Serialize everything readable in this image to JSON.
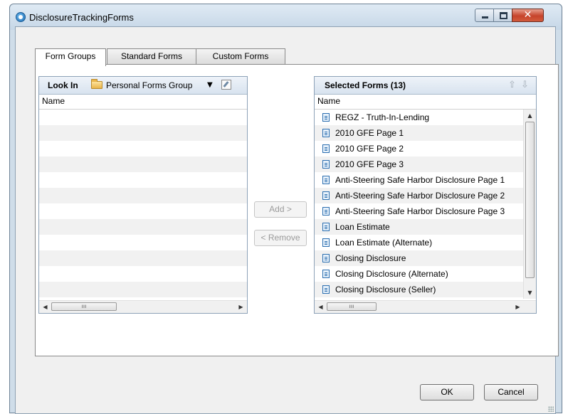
{
  "window": {
    "title": "DisclosureTrackingForms"
  },
  "tabs": [
    {
      "label": "Form Groups",
      "active": true
    },
    {
      "label": "Standard Forms",
      "active": false
    },
    {
      "label": "Custom Forms",
      "active": false
    }
  ],
  "left_panel": {
    "look_in_label": "Look In",
    "look_in_value": "Personal Forms Group",
    "column_header": "Name",
    "rows": [
      "",
      "",
      "",
      "",
      "",
      "",
      "",
      "",
      "",
      "",
      "",
      "",
      ""
    ]
  },
  "middle": {
    "add_label": "Add >",
    "remove_label": "< Remove"
  },
  "right_panel": {
    "title": "Selected Forms (13)",
    "column_header": "Name",
    "items": [
      "REGZ - Truth-In-Lending",
      "2010 GFE Page 1",
      "2010 GFE Page 2",
      "2010 GFE Page 3",
      "Anti-Steering Safe Harbor Disclosure Page 1",
      "Anti-Steering Safe Harbor Disclosure Page 2",
      "Anti-Steering Safe Harbor Disclosure Page 3",
      "Loan Estimate",
      "Loan Estimate (Alternate)",
      "Closing Disclosure",
      "Closing Disclosure (Alternate)",
      "Closing Disclosure (Seller)"
    ]
  },
  "footer": {
    "ok_label": "OK",
    "cancel_label": "Cancel"
  },
  "colors": {
    "frame": "#cfdde9",
    "panel_header": "#d8e3ef",
    "close_button": "#c6442b",
    "doc_icon": "#2d6fb0"
  },
  "icons": [
    "app-icon",
    "minimize-icon",
    "maximize-icon",
    "close-icon",
    "folder-icon",
    "dropdown-arrow-icon",
    "edit-icon",
    "move-up-icon",
    "move-down-icon",
    "document-icon"
  ]
}
